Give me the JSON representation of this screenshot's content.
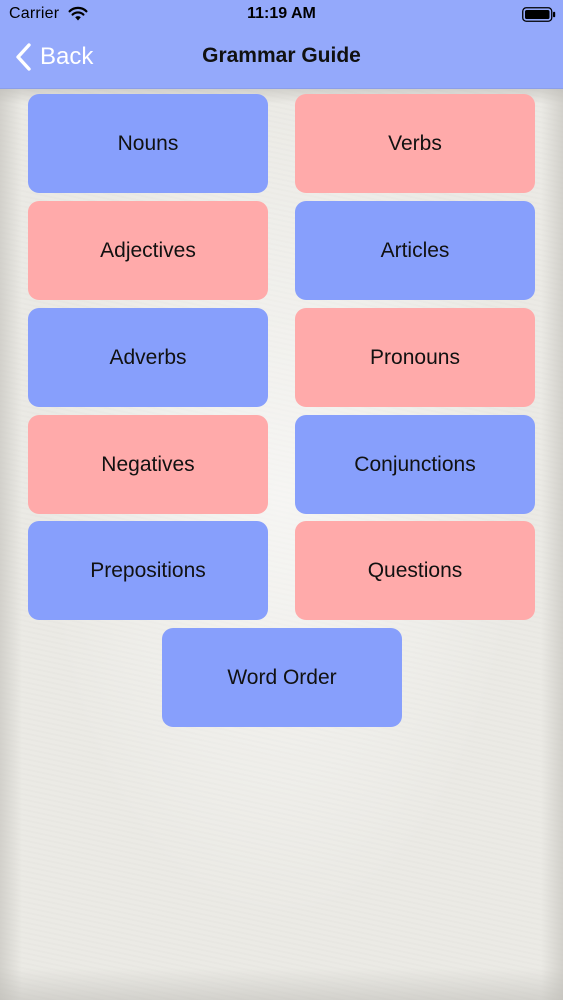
{
  "status_bar": {
    "carrier": "Carrier",
    "time": "11:19 AM"
  },
  "nav": {
    "back_label": "Back",
    "title": "Grammar Guide"
  },
  "colors": {
    "nav_bar": "#94a9fb",
    "blue_button": "#879ffc",
    "pink_button": "#ffaaaa"
  },
  "topics": [
    {
      "label": "Nouns",
      "color": "blue"
    },
    {
      "label": "Verbs",
      "color": "pink"
    },
    {
      "label": "Adjectives",
      "color": "pink"
    },
    {
      "label": "Articles",
      "color": "blue"
    },
    {
      "label": "Adverbs",
      "color": "blue"
    },
    {
      "label": "Pronouns",
      "color": "pink"
    },
    {
      "label": "Negatives",
      "color": "pink"
    },
    {
      "label": "Conjunctions",
      "color": "blue"
    },
    {
      "label": "Prepositions",
      "color": "blue"
    },
    {
      "label": "Questions",
      "color": "pink"
    },
    {
      "label": "Word Order",
      "color": "blue"
    }
  ]
}
